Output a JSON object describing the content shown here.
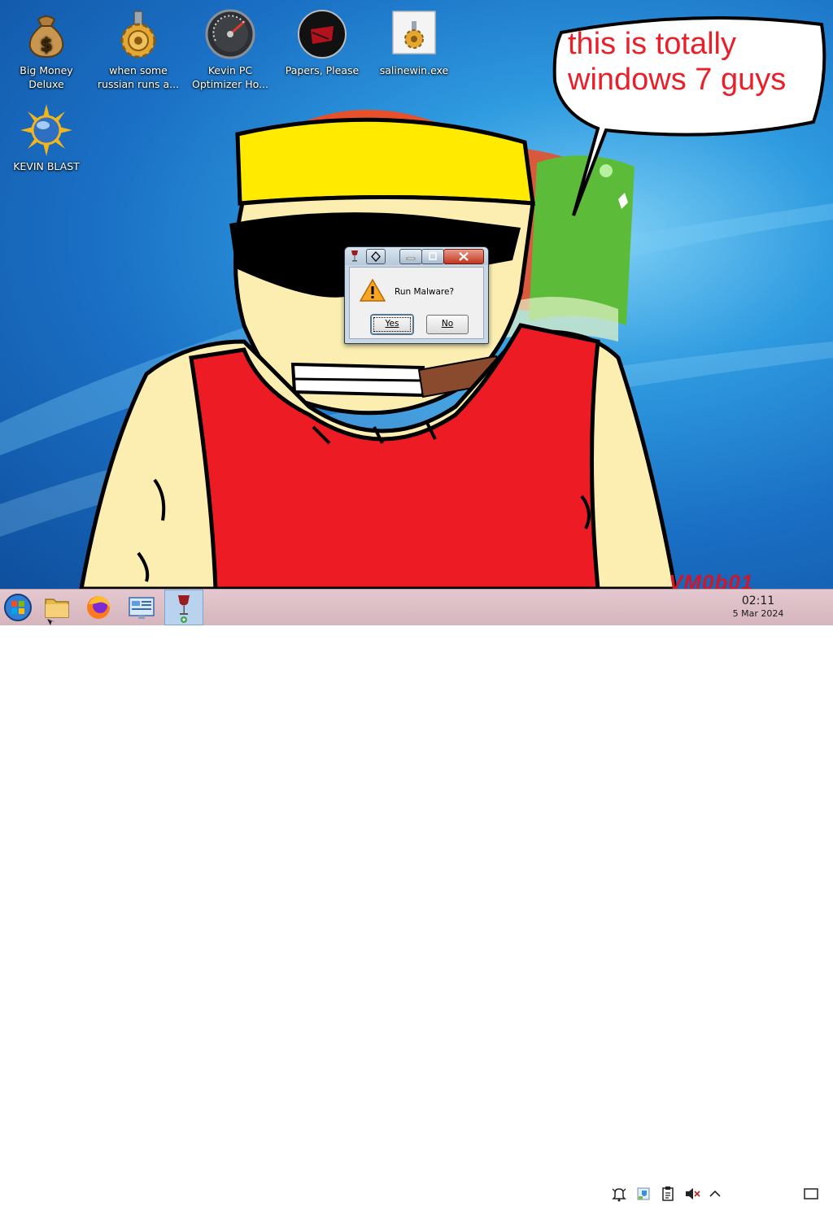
{
  "desktop": {
    "icons": [
      {
        "label": "Big Money Deluxe",
        "icon": "money-bag-icon"
      },
      {
        "label": "when some russian runs a...",
        "icon": "gear-icon"
      },
      {
        "label": "Kevin PC Optimizer Ho...",
        "icon": "speedometer-icon"
      },
      {
        "label": "Papers, Please",
        "icon": "papers-please-icon"
      },
      {
        "label": "salinewin.exe",
        "icon": "gear-exe-icon"
      },
      {
        "label": "KEVIN BLAST",
        "icon": "globe-sun-icon"
      }
    ],
    "speech_bubble": "this is totally windows 7 guys",
    "signature": "VM0b01"
  },
  "dialog": {
    "message": "Run Malware?",
    "yes_label": "Yes",
    "no_label": "No",
    "icon": "warning-icon"
  },
  "taskbar": {
    "items": [
      "start-orb-icon",
      "file-manager-icon",
      "firefox-icon",
      "system-settings-icon",
      "wine-app-icon"
    ],
    "tray": [
      "notifications-bell-icon",
      "security-shield-icon",
      "clipboard-icon",
      "volume-muted-icon",
      "chevron-up-icon"
    ],
    "clock_time": "02:11",
    "clock_date": "5 Mar 2024",
    "show_desktop": "show-desktop-icon"
  }
}
